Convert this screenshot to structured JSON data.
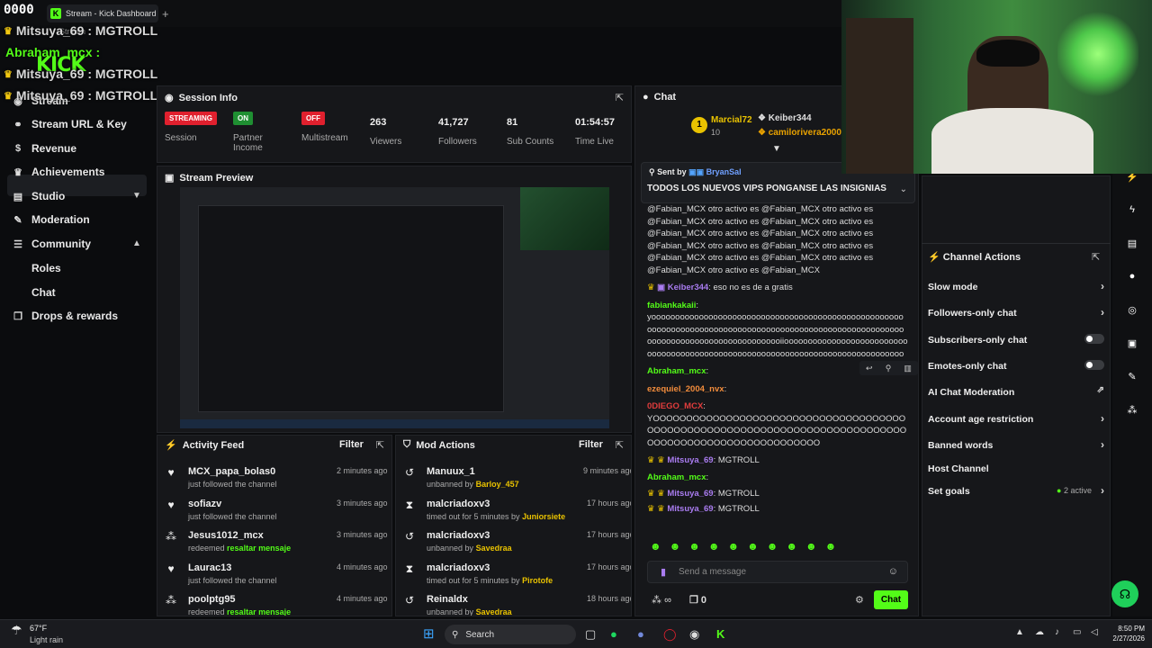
{
  "browser": {
    "counter": "0000",
    "tab_title": "Stream - Kick Dashboard",
    "url_fragment": "Stream"
  },
  "overlay": {
    "lines": [
      {
        "user": "Mitsuya_69",
        "text": ": MGTROLL"
      },
      {
        "user": "Abraham_mcx",
        "text": ":"
      },
      {
        "user": "Mitsuya_69",
        "text": ": MGTROLL"
      },
      {
        "user": "Mitsuya_69",
        "text": ": MGTROLL"
      }
    ],
    "logo": "KICK"
  },
  "sidebar": {
    "items": [
      {
        "label": "Stream",
        "icon": "broadcast-icon"
      },
      {
        "label": "Stream URL & Key",
        "icon": "link-icon"
      },
      {
        "label": "Revenue",
        "icon": "dollar-icon"
      },
      {
        "label": "Achievements",
        "icon": "trophy-icon"
      },
      {
        "label": "Studio",
        "icon": "studio-icon"
      },
      {
        "label": "Moderation",
        "icon": "wrench-icon"
      },
      {
        "label": "Community",
        "icon": "community-icon"
      },
      {
        "label": "Roles",
        "icon": ""
      },
      {
        "label": "Chat",
        "icon": ""
      },
      {
        "label": "Drops & rewards",
        "icon": "gift-icon"
      }
    ]
  },
  "session": {
    "title": "Session Info",
    "stats": [
      {
        "badge": "STREAMING",
        "label": "Session",
        "color": "#e0202e"
      },
      {
        "badge": "ON",
        "label": "Partner Income",
        "color": "#1f8f32"
      },
      {
        "badge": "OFF",
        "label": "Multistream",
        "color": "#e0202e"
      },
      {
        "value": "263",
        "label": "Viewers"
      },
      {
        "value": "41,727",
        "label": "Followers"
      },
      {
        "value": "81",
        "label": "Sub Counts"
      },
      {
        "value": "01:54:57",
        "label": "Time Live"
      }
    ]
  },
  "preview": {
    "title": "Stream Preview"
  },
  "activity": {
    "title": "Activity Feed",
    "filter": "Filter",
    "items": [
      {
        "name": "MCX_papa_bolas0",
        "sub": "just followed the channel",
        "highlight": "",
        "time": "2 minutes ago",
        "icon": "heart-icon"
      },
      {
        "name": "sofiazv",
        "sub": "just followed the channel",
        "highlight": "",
        "time": "3 minutes ago",
        "icon": "heart-icon"
      },
      {
        "name": "Jesus1012_mcx",
        "sub": "redeemed",
        "highlight": "resaltar mensaje",
        "time": "3 minutes ago",
        "icon": "points-icon"
      },
      {
        "name": "Laurac13",
        "sub": "just followed the channel",
        "highlight": "",
        "time": "4 minutes ago",
        "icon": "heart-icon"
      },
      {
        "name": "poolptg95",
        "sub": "redeemed",
        "highlight": "resaltar mensaje",
        "time": "4 minutes ago",
        "icon": "points-icon"
      }
    ]
  },
  "mod": {
    "title": "Mod Actions",
    "filter": "Filter",
    "items": [
      {
        "name": "Manuux_1",
        "sub": "unbanned by",
        "highlight": "Barloy_457",
        "time": "9 minutes ago",
        "icon": "unban-icon"
      },
      {
        "name": "malcriadoxv3",
        "sub": "timed out for 5 minutes by",
        "highlight": "Juniorsiete",
        "time": "17 hours ago",
        "icon": "hourglass-icon"
      },
      {
        "name": "malcriadoxv3",
        "sub": "unbanned by",
        "highlight": "Savedraa",
        "time": "17 hours ago",
        "icon": "unban-icon"
      },
      {
        "name": "malcriadoxv3",
        "sub": "timed out for 5 minutes by",
        "highlight": "Pirotofe",
        "time": "17 hours ago",
        "icon": "hourglass-icon"
      },
      {
        "name": "Reinaldx",
        "sub": "unbanned by",
        "highlight": "Savedraa",
        "time": "18 hours ago",
        "icon": "unban-icon"
      }
    ]
  },
  "chat": {
    "title": "Chat",
    "top_users": [
      "Marcial72",
      "Keiber344",
      "camilorivera2000"
    ],
    "top_count": "10",
    "pinned_label": "Sent by",
    "pinned_user": "BryanSal",
    "pinned_text": "TODOS LOS NUEVOS VIPS PONGANSE LAS INSIGNIAS",
    "spam": "@Fabian_MCX otro activo es @Fabian_MCX otro activo es",
    "spam_last": "@Fabian_MCX otro activo es @Fabian_MCX",
    "msg1_user": "Keiber344",
    "msg1_text": ": eso no es de a gratis",
    "msg2_user": "fabiankakaii",
    "msg2_text": ":",
    "msg2_body": "yoooooooooooooooooooooooooooooooooooooooooooooooooooooooooooooooooooooooooooooooooooooooooooooooooooooooooooooooooooooooooooooooooooooooiiooooooooooooooooooooooooooooooooooooooooooooooooooooooooooooooooooooooooooooooooo",
    "msg3_user": "Abraham_mcx",
    "msg3_text": ":",
    "msg4_user": "ezequiel_2004_nvx",
    "msg4_text": ":",
    "msg5_user": "0DIEGO_MCX",
    "msg5_text": ":",
    "msg5_body": "YOOOOOOOOOOOOOOOOOOOOOOOOOOOOOOOOOOOOOOOOOOOOOOOOOOOOOOOOOOOOOOOOOOOOOOOOOOOOOOOOOOOOOOOOOOOOOOOOOOOOOOO",
    "msg6_user": "Mitsuya_69",
    "msg6_text": ": MGTROLL",
    "msg7_user": "Abraham_mcx",
    "msg7_text": ":",
    "msg8_user": "Mitsuya_69",
    "msg8_text": ": MGTROLL",
    "msg9_user": "Mitsuya_69",
    "msg9_text": ": MGTROLL",
    "placeholder": "Send a message",
    "points": "∞",
    "count": "0",
    "send": "Chat"
  },
  "channel_actions": {
    "title": "Channel Actions",
    "items": [
      {
        "label": "Slow mode",
        "control": "chevron"
      },
      {
        "label": "Followers-only chat",
        "control": "chevron"
      },
      {
        "label": "Subscribers-only chat",
        "control": "toggle"
      },
      {
        "label": "Emotes-only chat",
        "control": "toggle"
      },
      {
        "label": "AI Chat Moderation",
        "control": "external"
      },
      {
        "label": "Account age restriction",
        "control": "chevron"
      },
      {
        "label": "Banned words",
        "control": "chevron"
      },
      {
        "label": "Host Channel",
        "control": "none"
      },
      {
        "label": "Set goals",
        "control": "chevron",
        "extra": "2 active"
      }
    ]
  },
  "taskbar": {
    "weather_temp": "67°F",
    "weather_desc": "Light rain",
    "search": "Search",
    "time": "8:50 PM",
    "date": "2/27/2026"
  },
  "colors": {
    "accent": "#53fc18",
    "panel": "#16171a",
    "bg": "#0b0c0e",
    "red": "#e0202e"
  }
}
